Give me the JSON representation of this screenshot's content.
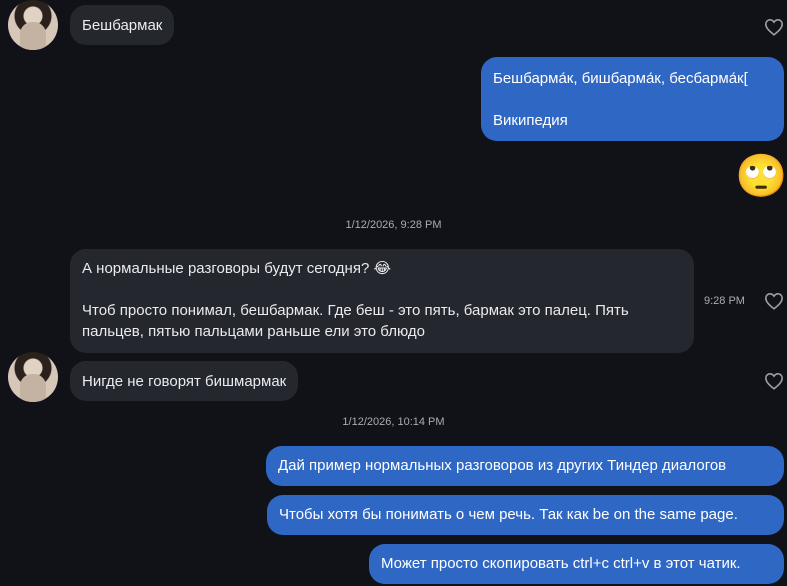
{
  "messages": {
    "m1": "Бешбармак",
    "m2_line1": "Бешбарма́к, бишбарма́к, бесбарма́к[",
    "m2_line2": "Википедия",
    "m3_line1": "А нормальные разговоры будут сегодня? 😂",
    "m3_line2": "Чтоб просто понимал, бешбармак. Где беш - это пять, бармак это палец. Пять",
    "m3_line3": "пальцев, пятью пальцами раньше ели это блюдо",
    "m4": "Нигде не говорят бишмармак",
    "m5": "Дай пример нормальных разговоров из других Тиндер диалогов",
    "m6": "Чтобы хотя бы понимать о чем речь. Так как be on the same page.",
    "m7": "Может просто скопировать ctrl+c ctrl+v в этот чатик."
  },
  "reaction_emoji": "🙄",
  "timestamps": {
    "divider1": "1/12/2026, 9:28 PM",
    "divider2": "1/12/2026, 10:14 PM",
    "m3_time": "9:28 PM"
  },
  "icons": {
    "like": "heart-outline-icon",
    "avatar": "profile-photo"
  },
  "colors": {
    "background": "#101217",
    "incoming_bubble": "#25272e",
    "outgoing_bubble": "#2f67c4"
  }
}
